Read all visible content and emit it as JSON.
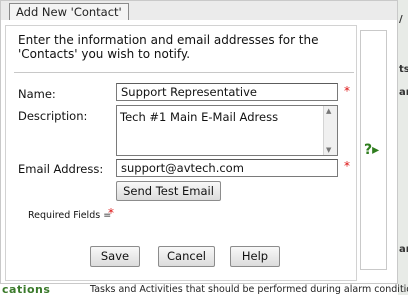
{
  "background": {
    "right_edge_texts": [
      "/",
      "ts",
      "ar",
      "ar"
    ],
    "bottom_green_text": "cations",
    "bottom_text": "Tasks and Activities that should be performed during alarm condition"
  },
  "dialog": {
    "title": "Add New 'Contact'",
    "intro": "Enter the information and email addresses for the 'Contacts' you wish to notify.",
    "form": {
      "name_label": "Name:",
      "name_value": "Support Representative",
      "description_label": "Description:",
      "description_value": "Tech #1 Main E-Mail Adress",
      "email_label": "Email Address:",
      "email_value": "support@avtech.com",
      "required_marker": "*",
      "send_test_label": "Send Test Email",
      "required_fields_label": "Required Fields ="
    },
    "buttons": {
      "save": "Save",
      "cancel": "Cancel",
      "help": "Help"
    },
    "help_icon_glyph": "?▸"
  },
  "colors": {
    "required": "#dd1111",
    "help_icon": "#2f7d1e"
  }
}
